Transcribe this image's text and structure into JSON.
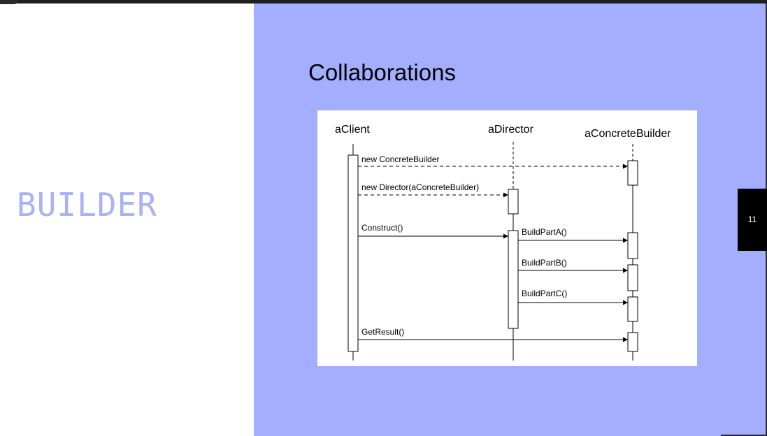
{
  "slide": {
    "title": "BUILDER",
    "heading": "Collaborations",
    "page_number": "11"
  },
  "diagram": {
    "participants": [
      "aClient",
      "aDirector",
      "aConcreteBuilder"
    ],
    "messages": [
      {
        "label": "new ConcreteBuilder",
        "kind": "create"
      },
      {
        "label": "new Director(aConcreteBuilder)",
        "kind": "create"
      },
      {
        "label": "Construct()",
        "kind": "call"
      },
      {
        "label": "BuildPartA()",
        "kind": "call"
      },
      {
        "label": "BuildPartB()",
        "kind": "call"
      },
      {
        "label": "BuildPartC()",
        "kind": "call"
      },
      {
        "label": "GetResult()",
        "kind": "call"
      }
    ]
  },
  "colors": {
    "panel": "#a4aeff",
    "title": "#a7b3f5"
  }
}
